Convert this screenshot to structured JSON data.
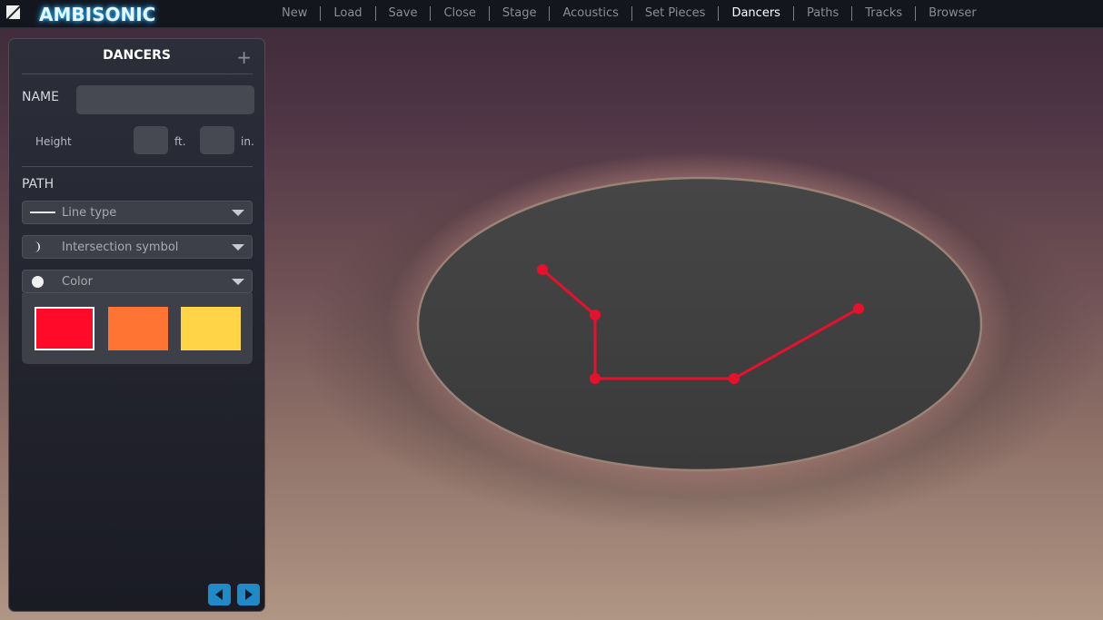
{
  "app": {
    "title": "AMBISONIC",
    "icon": "app-logo-icon"
  },
  "nav": {
    "items": [
      "New",
      "Load",
      "Save",
      "Close",
      "Stage",
      "Acoustics",
      "Set Pieces",
      "Dancers",
      "Paths",
      "Tracks",
      "Browser"
    ],
    "active": "Dancers"
  },
  "panel": {
    "title": "DANCERS",
    "add_icon": "plus-icon",
    "name_label": "NAME",
    "name_value": "",
    "height_label": "Height",
    "feet_value": "",
    "feet_unit": "ft.",
    "inches_value": "",
    "inches_unit": "in.",
    "path_label": "PATH",
    "line_type": {
      "label": "Line type",
      "icon": "line-icon"
    },
    "intersection": {
      "label": "Intersection symbol",
      "icon": "crescent-icon"
    },
    "color": {
      "label": "Color",
      "icon": "circle-icon"
    },
    "swatches": [
      {
        "color": "#ff0a28",
        "selected": true
      },
      {
        "color": "#ff7432",
        "selected": false
      },
      {
        "color": "#ffd447",
        "selected": false
      }
    ],
    "prev_icon": "arrow-left-icon",
    "next_icon": "arrow-right-icon"
  },
  "stage": {
    "path_color": "#e8112d"
  }
}
